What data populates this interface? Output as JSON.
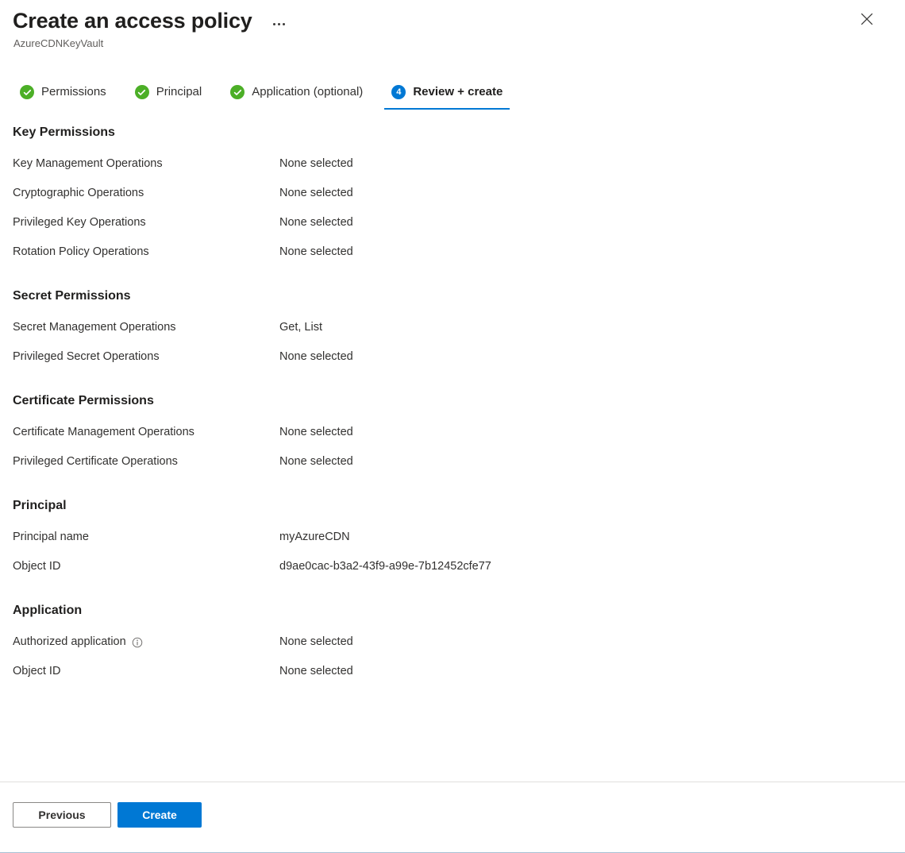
{
  "header": {
    "title": "Create an access policy",
    "subtitle": "AzureCDNKeyVault",
    "more_menu_label": "More",
    "close_label": "Close"
  },
  "tabs": [
    {
      "label": "Permissions",
      "state": "complete",
      "icon": "check-circle-icon"
    },
    {
      "label": "Principal",
      "state": "complete",
      "icon": "check-circle-icon"
    },
    {
      "label": "Application (optional)",
      "state": "complete",
      "icon": "check-circle-icon"
    },
    {
      "label": "Review + create",
      "state": "active",
      "step": "4"
    }
  ],
  "sections": [
    {
      "title": "Key Permissions",
      "rows": [
        {
          "label": "Key Management Operations",
          "value": "None selected"
        },
        {
          "label": "Cryptographic Operations",
          "value": "None selected"
        },
        {
          "label": "Privileged Key Operations",
          "value": "None selected"
        },
        {
          "label": "Rotation Policy Operations",
          "value": "None selected"
        }
      ]
    },
    {
      "title": "Secret Permissions",
      "rows": [
        {
          "label": "Secret Management Operations",
          "value": "Get, List"
        },
        {
          "label": "Privileged Secret Operations",
          "value": "None selected"
        }
      ]
    },
    {
      "title": "Certificate Permissions",
      "rows": [
        {
          "label": "Certificate Management Operations",
          "value": "None selected"
        },
        {
          "label": "Privileged Certificate Operations",
          "value": "None selected"
        }
      ]
    },
    {
      "title": "Principal",
      "rows": [
        {
          "label": "Principal name",
          "value": "myAzureCDN"
        },
        {
          "label": "Object ID",
          "value": "d9ae0cac-b3a2-43f9-a99e-7b12452cfe77"
        }
      ]
    },
    {
      "title": "Application",
      "rows": [
        {
          "label": "Authorized application",
          "value": "None selected",
          "info": true
        },
        {
          "label": "Object ID",
          "value": "None selected"
        }
      ]
    }
  ],
  "footer": {
    "previous_label": "Previous",
    "create_label": "Create"
  },
  "colors": {
    "accent": "#0078d4",
    "success": "#4caf27",
    "text": "#323130",
    "muted": "#605e5c",
    "divider": "#e1dfdd"
  }
}
